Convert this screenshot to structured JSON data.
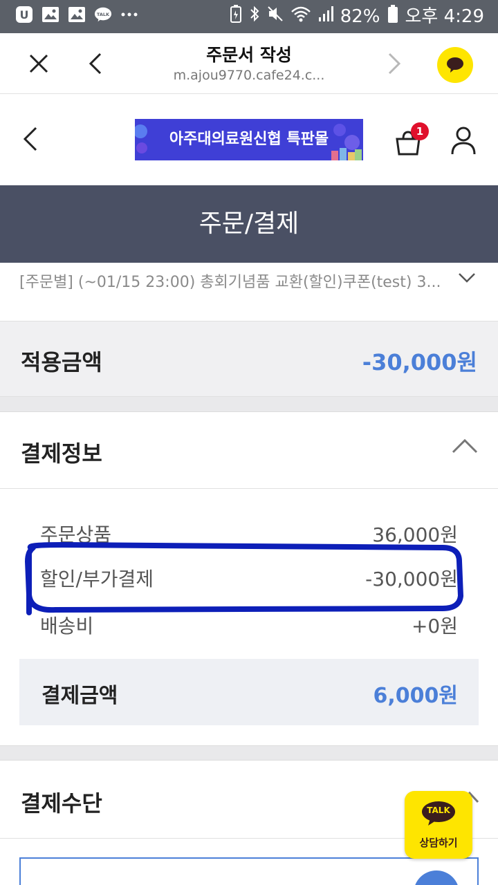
{
  "status_bar": {
    "battery": "82%",
    "time": "오후 4:29",
    "icons": [
      "u-plus-icon",
      "gallery-icon",
      "gallery-icon",
      "kakaotalk-icon",
      "more-dots-icon",
      "battery-saver-icon",
      "bluetooth-icon",
      "mute-icon",
      "wifi-icon",
      "signal-icon",
      "battery-icon"
    ]
  },
  "browser": {
    "title": "주문서 작성",
    "url": "m.ajou9770.cafe24.c..."
  },
  "site": {
    "logo_text": "아주대의료원신협 특판몰",
    "cart_count": "1"
  },
  "page": {
    "title": "주문/결제"
  },
  "coupon": {
    "text": "[주문별] (~01/15 23:00) 총회기념품 교환(할인)쿠폰(test) 3..."
  },
  "applied": {
    "label": "적용금액",
    "value": "-30,000원"
  },
  "payment_info": {
    "title": "결제정보",
    "rows": [
      {
        "label": "주문상품",
        "value": "36,000원"
      },
      {
        "label": "할인/부가결제",
        "value": "-30,000원"
      },
      {
        "label": "배송비",
        "value": "+0원"
      }
    ],
    "total_label": "결제금액",
    "total_value": "6,000원"
  },
  "payment_method": {
    "title": "결제수단"
  },
  "talk_button": {
    "badge": "TALK",
    "label": "상담하기"
  },
  "colors": {
    "status_bar": "#5b6068",
    "title_bar": "#4a5064",
    "accent_blue": "#4b7fd8",
    "kakao_yellow": "#fee500",
    "annotation_blue": "#0d1fb8"
  }
}
